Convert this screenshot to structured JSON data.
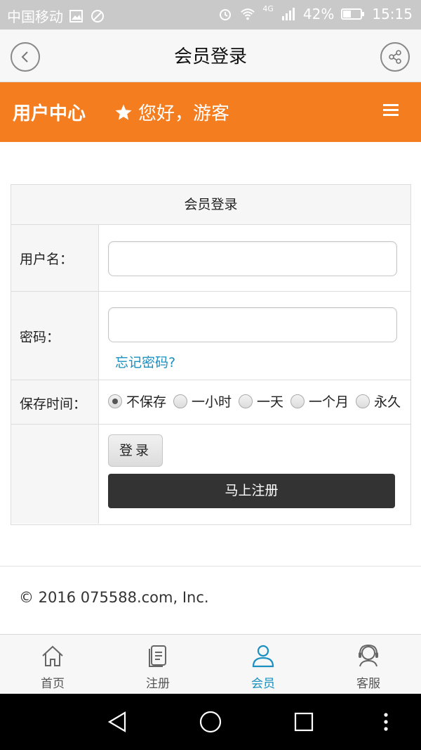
{
  "status_bar": {
    "carrier": "中国移动",
    "network": "4G",
    "battery": "42%",
    "time": "15:15"
  },
  "title_bar": {
    "title": "会员登录",
    "back_icon": "back-icon",
    "share_icon": "share-icon"
  },
  "header": {
    "user_center": "用户中心",
    "greeting": "您好，游客",
    "star_icon": "star-icon",
    "menu_icon": "menu-icon"
  },
  "login_form": {
    "title": "会员登录",
    "username_label": "用户名：",
    "username_value": "",
    "password_label": "密码：",
    "password_value": "",
    "forgot_link": "忘记密码?",
    "save_time_label": "保存时间：",
    "save_options": [
      "不保存",
      "一小时",
      "一天",
      "一个月",
      "永久"
    ],
    "save_selected": "不保存",
    "login_button": "登录",
    "register_button": "马上注册"
  },
  "footer": {
    "copyright": "© 2016 075588.com, Inc."
  },
  "tab_bar": {
    "tabs": [
      {
        "label": "首页",
        "icon": "home-icon"
      },
      {
        "label": "注册",
        "icon": "document-icon"
      },
      {
        "label": "会员",
        "icon": "user-icon"
      },
      {
        "label": "客服",
        "icon": "headset-icon"
      }
    ],
    "active": "会员"
  },
  "colors": {
    "header_orange": "#f47d20",
    "link_blue": "#1a8fc0",
    "register_button": "#333333"
  }
}
